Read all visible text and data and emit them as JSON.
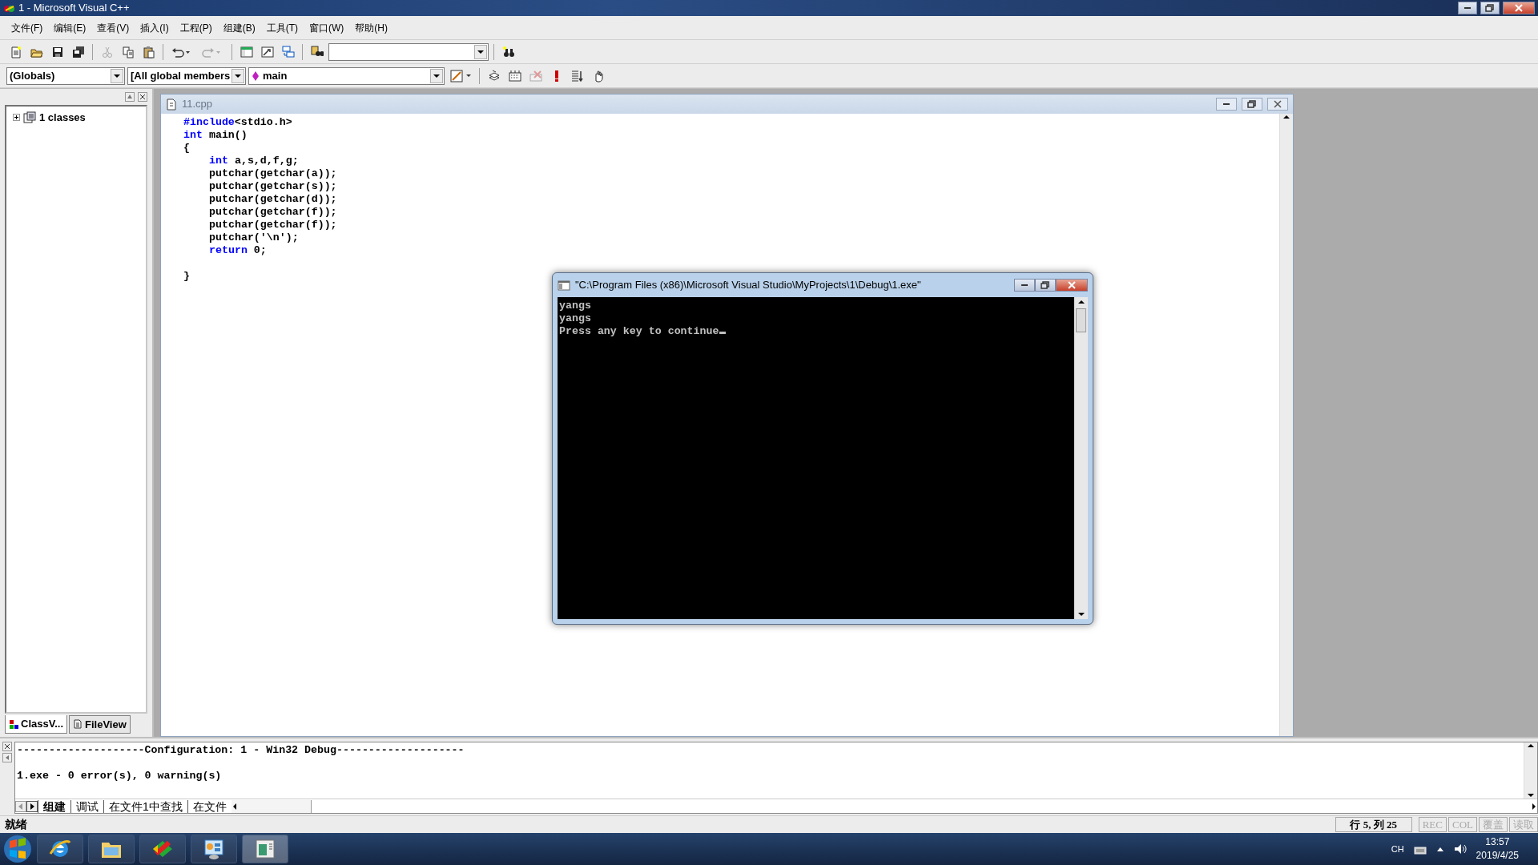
{
  "window": {
    "title": "1 - Microsoft Visual C++"
  },
  "menu": [
    "文件(F)",
    "编辑(E)",
    "查看(V)",
    "插入(I)",
    "工程(P)",
    "组建(B)",
    "工具(T)",
    "窗口(W)",
    "帮助(H)"
  ],
  "standard_toolbar": [
    {
      "disabled": false
    },
    {
      "disabled": false
    },
    {
      "disabled": false
    },
    {
      "disabled": false
    },
    {
      "disabled": true
    },
    {
      "disabled": false
    },
    {
      "disabled": false
    },
    {
      "disabled": false
    },
    {
      "disabled": true
    },
    {
      "disabled": false
    },
    {
      "disabled": false
    },
    {
      "disabled": false
    },
    {
      "disabled": false
    },
    {
      "disabled": false
    }
  ],
  "wizard_bar": {
    "scope": "(Globals)",
    "members": "[All global members",
    "function": "main"
  },
  "build_toolbar": [
    {
      "disabled": false
    },
    {
      "disabled": false
    },
    {
      "disabled": true
    },
    {
      "disabled": false
    },
    {
      "disabled": false
    },
    {
      "disabled": false
    }
  ],
  "class_view": {
    "items": [
      {
        "label": "1 classes",
        "expanded": false
      }
    ]
  },
  "panel_tabs": [
    {
      "label": "ClassV...",
      "selected": true
    },
    {
      "label": "FileView",
      "selected": false
    }
  ],
  "editor": {
    "title": "11.cpp",
    "lines": [
      {
        "indented": false,
        "parts": [
          {
            "kind": "keyword",
            "text": "#include"
          },
          {
            "kind": "plain",
            "text": "<stdio.h>"
          }
        ]
      },
      {
        "indented": false,
        "parts": [
          {
            "kind": "keyword",
            "text": "int"
          },
          {
            "kind": "plain",
            "text": " main()"
          }
        ]
      },
      {
        "indented": false,
        "parts": [
          {
            "kind": "plain",
            "text": "{"
          }
        ]
      },
      {
        "indented": true,
        "parts": [
          {
            "kind": "keyword",
            "text": "int"
          },
          {
            "kind": "plain",
            "text": " a,s,d,f,g;"
          }
        ]
      },
      {
        "indented": true,
        "parts": [
          {
            "kind": "plain",
            "text": "putchar(getchar(a));"
          }
        ]
      },
      {
        "indented": true,
        "parts": [
          {
            "kind": "plain",
            "text": "putchar(getchar(s));"
          }
        ]
      },
      {
        "indented": true,
        "parts": [
          {
            "kind": "plain",
            "text": "putchar(getchar(d));"
          }
        ]
      },
      {
        "indented": true,
        "parts": [
          {
            "kind": "plain",
            "text": "putchar(getchar(f));"
          }
        ]
      },
      {
        "indented": true,
        "parts": [
          {
            "kind": "plain",
            "text": "putchar(getchar(f));"
          }
        ]
      },
      {
        "indented": true,
        "parts": [
          {
            "kind": "plain",
            "text": "putchar('\\n');"
          }
        ]
      },
      {
        "indented": true,
        "parts": [
          {
            "kind": "keyword",
            "text": "return"
          },
          {
            "kind": "plain",
            "text": " 0;"
          }
        ]
      },
      {
        "indented": false,
        "blank_before": true,
        "parts": [
          {
            "kind": "plain",
            "text": "}"
          }
        ]
      }
    ]
  },
  "console": {
    "title": "\"C:\\Program Files (x86)\\Microsoft Visual Studio\\MyProjects\\1\\Debug\\1.exe\"",
    "lines": [
      "yangs",
      "yangs",
      "Press any key to continue"
    ]
  },
  "output": {
    "lines": [
      "--------------------Configuration: 1 - Win32 Debug--------------------",
      "1.exe - 0 error(s), 0 warning(s)"
    ],
    "tabs": [
      {
        "label": "组建",
        "selected": true
      },
      {
        "label": "调试",
        "selected": false
      },
      {
        "label": "在文件1中查找",
        "selected": false
      },
      {
        "label": "在文件",
        "selected": false
      }
    ]
  },
  "status_bar": {
    "message": "就绪",
    "position": "行 5, 列 25",
    "indicators": [
      {
        "label": "REC",
        "on": false
      },
      {
        "label": "COL",
        "on": false
      },
      {
        "label": "覆盖",
        "on": false
      },
      {
        "label": "读取",
        "on": false
      }
    ]
  },
  "taskbar": {
    "language": "CH",
    "time": "13:57",
    "date": "2019/4/25"
  }
}
